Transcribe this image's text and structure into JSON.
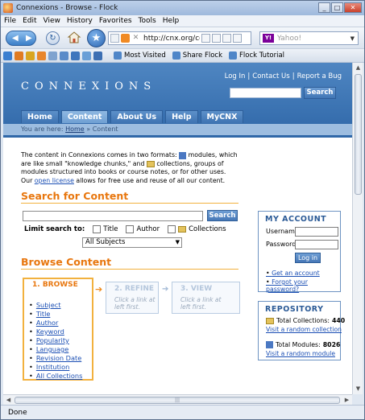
{
  "window": {
    "title": "Connexions - Browse - Flock",
    "min": "_",
    "max": "□",
    "close": "✕"
  },
  "menu": [
    "File",
    "Edit",
    "View",
    "History",
    "Favorites",
    "Tools",
    "Help"
  ],
  "nav": {
    "url": "http://cnx.org/co",
    "search_engine_placeholder": "Yahoo!"
  },
  "bookmarks": [
    "Most Visited",
    "Share Flock",
    "Flock Tutorial"
  ],
  "site": {
    "logo": "CONNEXIONS",
    "top_links": [
      "Log In",
      "Contact Us",
      "Report a Bug"
    ],
    "search_button": "Search",
    "tabs": [
      "Home",
      "Content",
      "About Us",
      "Help",
      "MyCNX"
    ],
    "breadcrumb_prefix": "You are here:",
    "breadcrumb_home": "Home",
    "breadcrumb_current": "Content"
  },
  "intro": {
    "p1": "The content in Connexions comes in two formats:",
    "p2": "modules, which are like small \"knowledge chunks,\" and",
    "p3": "collections, groups of modules structured into books or course notes, or for other uses. Our",
    "license_link": "open license",
    "p4": "allows for free use and reuse of all our content."
  },
  "search": {
    "heading": "Search for Content",
    "button": "Search",
    "limit_label": "Limit search to:",
    "options": [
      "Title",
      "Author",
      "Collections"
    ],
    "subjects_value": "All Subjects"
  },
  "browse": {
    "heading": "Browse Content",
    "step1": "1. BROWSE",
    "step2": "2. REFINE",
    "step3": "3. VIEW",
    "hint2": "Click a link at left first.",
    "hint3": "Click a link at left first.",
    "items": [
      "Subject",
      "Title",
      "Author",
      "Keyword",
      "Popularity",
      "Language",
      "Revision Date",
      "Institution",
      "All Collections"
    ]
  },
  "account": {
    "heading": "MY ACCOUNT",
    "username_label": "Username",
    "password_label": "Password",
    "login_button": "Log in",
    "links": [
      "Get an account",
      "Forgot your password?"
    ]
  },
  "repository": {
    "heading": "REPOSITORY",
    "collections_label": "Total Collections:",
    "collections_count": "440",
    "collections_link": "Visit a random collection",
    "modules_label": "Total Modules:",
    "modules_count": "8026",
    "modules_link": "Visit a random module"
  },
  "status": "Done",
  "colors": {
    "accent_orange": "#e8770f",
    "header_blue": "#3f74b4",
    "link": "#1b4fb4"
  }
}
